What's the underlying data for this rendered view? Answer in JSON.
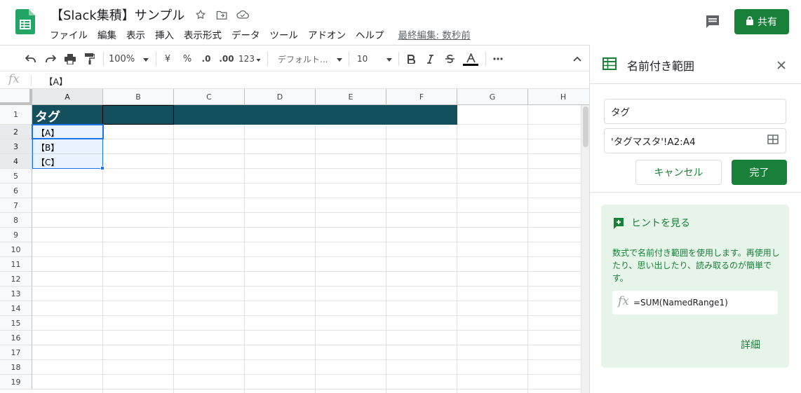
{
  "header": {
    "doc_title": "【Slack集積】サンプル",
    "menu": [
      "ファイル",
      "編集",
      "表示",
      "挿入",
      "表示形式",
      "データ",
      "ツール",
      "アドオン",
      "ヘルプ"
    ],
    "last_edit": "最終編集: 数秒前",
    "share_label": "共有",
    "colors": {
      "brand_green": "#188038",
      "sheets_logo": "#23a566"
    }
  },
  "toolbar": {
    "zoom": "100%",
    "currency": "¥",
    "percent": "%",
    "decrease_decimal": ".0",
    "increase_decimal": ".00",
    "more_formats": "123",
    "font": "デフォルト...",
    "font_size": "10"
  },
  "formula_bar": {
    "fx": "fx",
    "value": "【A】"
  },
  "grid": {
    "columns": [
      "A",
      "B",
      "C",
      "D",
      "E",
      "F",
      "G",
      "H"
    ],
    "rows": [
      "1",
      "2",
      "3",
      "4",
      "5",
      "6",
      "7",
      "8",
      "9",
      "10",
      "11",
      "12",
      "13",
      "14",
      "15",
      "16",
      "17",
      "18",
      "19"
    ],
    "cells": {
      "A1": "タグ",
      "A2": "【A】",
      "A3": "【B】",
      "A4": "【C】"
    },
    "header_fill": "#134f5c"
  },
  "panel": {
    "title": "名前付き範囲",
    "name_value": "タグ",
    "range_value": "'タグマスタ'!A2:A4",
    "cancel_label": "キャンセル",
    "done_label": "完了",
    "hint_title": "ヒントを見る",
    "hint_desc": "数式で名前付き範囲を使用します。再使用したり、思い出したり、読み取るのが簡単です。",
    "example_fx": "fx",
    "example": "=SUM(NamedRange1)",
    "details_link": "詳細"
  }
}
